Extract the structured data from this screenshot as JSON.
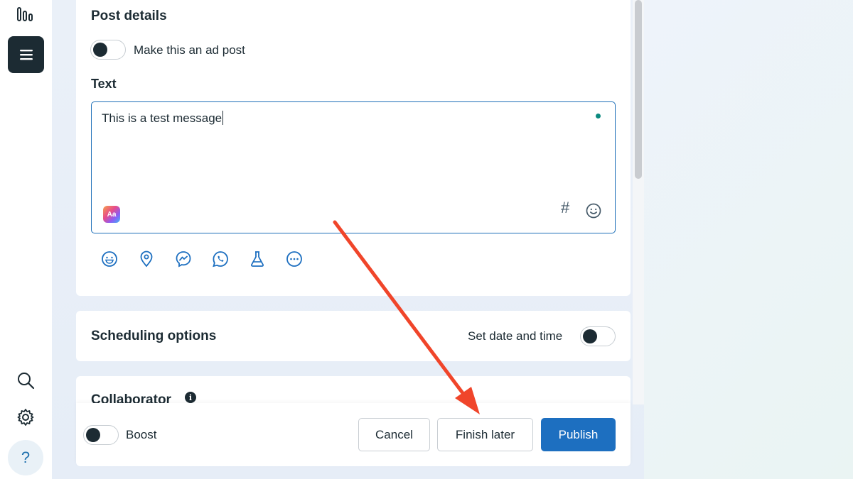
{
  "rail": {
    "logo_icon": "analytics-bars-icon",
    "menu_icon": "hamburger-menu-icon",
    "search_icon": "search-icon",
    "settings_icon": "gear-icon",
    "help_label": "?"
  },
  "post_details": {
    "title": "Post details",
    "ad_toggle_label": "Make this an ad post",
    "ad_toggle_on": false,
    "text_label": "Text",
    "text_value": "This is a test message",
    "toolbar_icons": [
      "emoji-icon",
      "location-icon",
      "messenger-icon",
      "whatsapp-icon",
      "flask-icon",
      "more-icon"
    ],
    "textbox_icons": [
      "text-style-icon",
      "hashtag-icon",
      "emoji-icon"
    ],
    "aa_label": "Aa",
    "hash_label": "#"
  },
  "scheduling": {
    "title": "Scheduling options",
    "toggle_label": "Set date and time",
    "toggle_on": false
  },
  "collaborator": {
    "title": "Collaborator",
    "info_icon": "info-icon"
  },
  "footer": {
    "boost_label": "Boost",
    "boost_on": false,
    "cancel_label": "Cancel",
    "finish_later_label": "Finish later",
    "publish_label": "Publish"
  },
  "colors": {
    "primary": "#1d6fc0",
    "dark": "#1c2b33",
    "annotation_arrow": "#f0452a",
    "status_dot": "#0b8a7f"
  }
}
